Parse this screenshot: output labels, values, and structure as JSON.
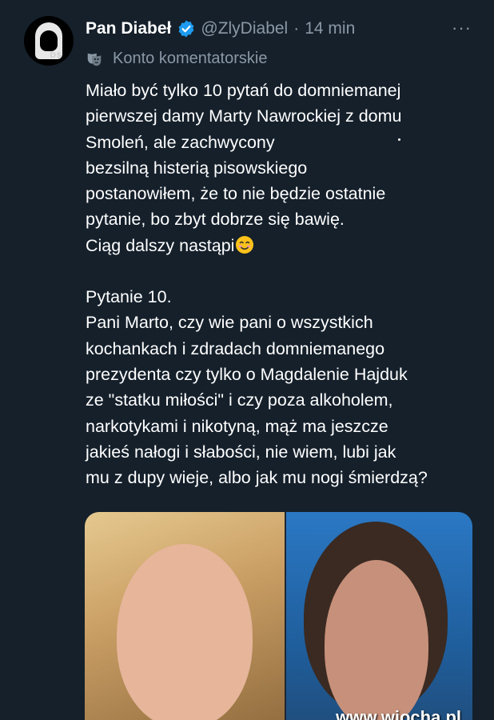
{
  "tweet": {
    "display_name": "Pan Diabeł",
    "handle": "@ZlyDiabel",
    "separator": "·",
    "time": "14 min",
    "more_label": "···",
    "account_label": "Konto komentatorskie",
    "paragraph_1": "Miało być tylko 10 pytań do domniemanej\npierwszej damy Marty Nawrockiej z domu\nSmoleń, ale zachwycony\nbezsilną histerią pisowskiego\npostanowiłem, że to nie będzie ostatnie\npytanie, bo zbyt dobrze się bawię.\nCiąg dalszy nastąpi",
    "paragraph_2": "Pytanie 10.\nPani Marto, czy wie pani o wszystkich\nkochankach i zdradach domniemanego\nprezydenta czy tylko o Magdalenie Hajduk\nze \"statku miłości\" i czy poza alkoholem,\nnarkotykami i nikotyną, mąż ma jeszcze\njakieś nałogi i słabości, nie wiem, lubi jak\nmu z dupy wieje, albo jak mu nogi śmierdzą?"
  },
  "avatar_tag": "D$",
  "icons": {
    "verified": "verified-badge-icon",
    "account": "theater-mask-icon",
    "emoji": "smiling-face-emoji",
    "more": "more-options-icon"
  },
  "colors": {
    "background": "#15202b",
    "verified": "#1d9bf0",
    "secondary_text": "#8b98a5"
  },
  "watermark": "www.wiocha.pl"
}
